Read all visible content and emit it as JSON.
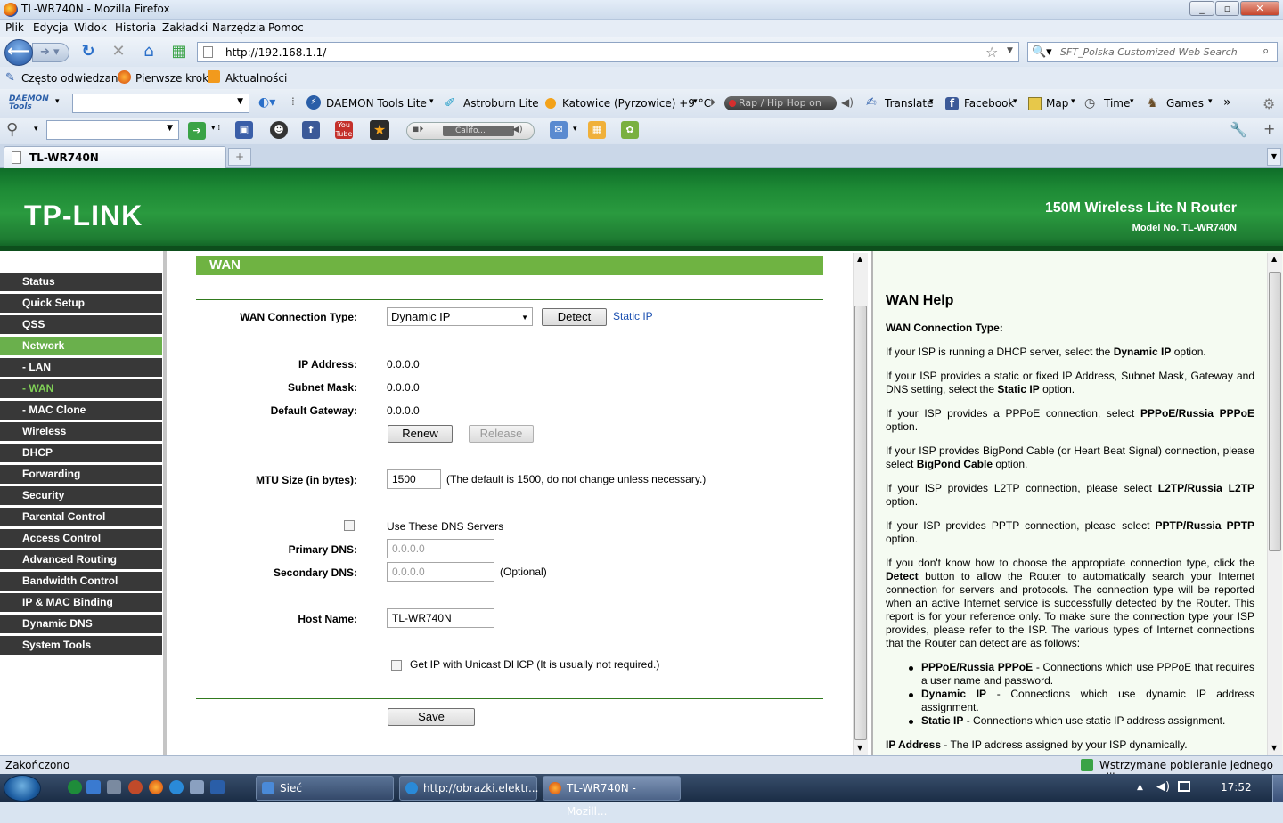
{
  "window": {
    "title": "TL-WR740N - Mozilla Firefox"
  },
  "menubar": [
    "Plik",
    "Edycja",
    "Widok",
    "Historia",
    "Zakładki",
    "Narzędzia",
    "Pomoc"
  ],
  "address": {
    "url": "http://192.168.1.1/"
  },
  "search": {
    "placeholder": "SFT_Polska Customized Web Search"
  },
  "bookmarks": [
    "Często odwiedzane",
    "Pierwsze kroki",
    "Aktualności"
  ],
  "toolbar1": {
    "daemon_logo": "DAEMON Tools",
    "daemon_lite": "DAEMON Tools Lite",
    "astroburn": "Astroburn Lite",
    "weather": "Katowice (Pyrzowice) +9 °C",
    "radio": "Rap / Hip Hop on",
    "translate": "Translate",
    "facebook": "Facebook",
    "map": "Map",
    "time": "Time",
    "games": "Games",
    "more": "»"
  },
  "toolbar2": {
    "player": "Califo..."
  },
  "tab": {
    "title": "TL-WR740N"
  },
  "router": {
    "brand": "TP-LINK",
    "product": "150M Wireless Lite N Router",
    "model": "Model No. TL-WR740N",
    "menu": [
      {
        "label": "Status"
      },
      {
        "label": "Quick Setup"
      },
      {
        "label": "QSS"
      },
      {
        "label": "Network"
      },
      {
        "label": "- LAN"
      },
      {
        "label": "- WAN"
      },
      {
        "label": "- MAC Clone"
      },
      {
        "label": "Wireless"
      },
      {
        "label": "DHCP"
      },
      {
        "label": "Forwarding"
      },
      {
        "label": "Security"
      },
      {
        "label": "Parental Control"
      },
      {
        "label": "Access Control"
      },
      {
        "label": "Advanced Routing"
      },
      {
        "label": "Bandwidth Control"
      },
      {
        "label": "IP & MAC Binding"
      },
      {
        "label": "Dynamic DNS"
      },
      {
        "label": "System Tools"
      }
    ],
    "page_title": "WAN",
    "form": {
      "conn_type_label": "WAN Connection Type:",
      "conn_type_value": "Dynamic IP",
      "detect": "Detect",
      "static_ip_link": "Static IP",
      "ip_label": "IP Address:",
      "ip_value": "0.0.0.0",
      "mask_label": "Subnet Mask:",
      "mask_value": "0.0.0.0",
      "gw_label": "Default Gateway:",
      "gw_value": "0.0.0.0",
      "renew": "Renew",
      "release": "Release",
      "mtu_label": "MTU Size (in bytes):",
      "mtu_value": "1500",
      "mtu_note": "(The default is 1500, do not change unless necessary.)",
      "dns_check_label": "Use These DNS Servers",
      "pdns_label": "Primary DNS:",
      "pdns_value": "0.0.0.0",
      "sdns_label": "Secondary DNS:",
      "sdns_value": "0.0.0.0",
      "sdns_note": "(Optional)",
      "host_label": "Host Name:",
      "host_value": "TL-WR740N",
      "unicast_label": "Get IP with Unicast DHCP (It is usually not required.)",
      "save": "Save"
    },
    "help": {
      "title": "WAN Help",
      "subtitle": "WAN Connection Type:",
      "p1_a": "If your ISP is running a DHCP server, select the ",
      "p1_b": "Dynamic IP",
      "p1_c": " option.",
      "p2_a": "If your ISP provides a static or fixed IP Address, Subnet Mask, Gateway and DNS setting, select the ",
      "p2_b": "Static IP",
      "p2_c": " option.",
      "p3_a": "If your ISP provides a PPPoE connection, select ",
      "p3_b": "PPPoE/Russia PPPoE",
      "p3_c": " option.",
      "p4_a": "If your ISP provides BigPond Cable (or Heart Beat Signal) connection, please select ",
      "p4_b": "BigPond Cable",
      "p4_c": " option.",
      "p5_a": "If your ISP provides L2TP connection, please select ",
      "p5_b": "L2TP/Russia L2TP",
      "p5_c": " option.",
      "p6_a": "If your ISP provides PPTP connection, please select ",
      "p6_b": "PPTP/Russia PPTP",
      "p6_c": " option.",
      "p7_a": "If you don't know how to choose the appropriate connection type, click the ",
      "p7_b": "Detect",
      "p7_c": " button to allow the Router to automatically search your Internet connection for servers and protocols. The connection type will be reported when an active Internet service is successfully detected by the Router. This report is for your reference only. To make sure the connection type your ISP provides, please refer to the ISP. The various types of Internet connections that the Router can detect are as follows:",
      "b1_a": "PPPoE/Russia PPPoE",
      "b1_b": " - Connections which use PPPoE that requires a user name and password.",
      "b2_a": "Dynamic IP",
      "b2_b": " - Connections which use dynamic IP address assignment.",
      "b3_a": "Static IP",
      "b3_b": " - Connections which use static IP address assignment.",
      "p8_a": "IP Address",
      "p8_b": " - The IP address assigned by your ISP dynamically."
    }
  },
  "statusbar": {
    "left": "Zakończono",
    "right": "Wstrzymane pobieranie jednego pliku"
  },
  "taskbar": {
    "tasks": [
      "Sieć",
      "http://obrazki.elektr...",
      "TL-WR740N - Mozill..."
    ],
    "clock": "17:52"
  }
}
